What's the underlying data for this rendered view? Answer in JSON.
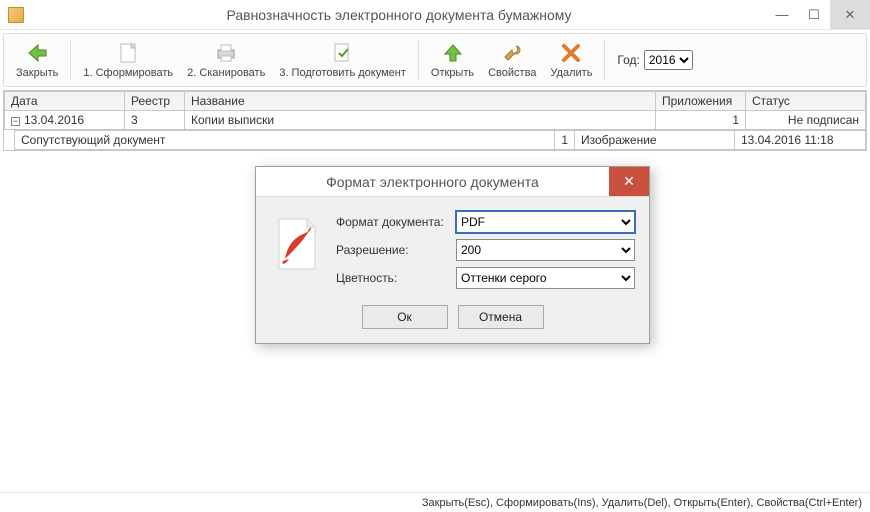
{
  "window": {
    "title": "Равнозначность электронного документа бумажному"
  },
  "toolbar": {
    "close": "Закрыть",
    "form": "1. Сформировать",
    "scan": "2. Сканировать",
    "prepare": "3. Подготовить документ",
    "open": "Открыть",
    "props": "Свойства",
    "delete": "Удалить",
    "year_label": "Год:",
    "year_value": "2016"
  },
  "grid": {
    "headers": {
      "date": "Дата",
      "registry": "Реестр",
      "name": "Название",
      "attachments": "Приложения",
      "status": "Статус"
    },
    "row1": {
      "date": "13.04.2016",
      "registry": "3",
      "name": "Копии выписки",
      "attachments": "1",
      "status": "Не подписан"
    },
    "row2": {
      "doc_type": "Сопутствующий документ",
      "num": "1",
      "image": "Изображение",
      "ts": "13.04.2016 11:18"
    }
  },
  "modal": {
    "title": "Формат электронного документа",
    "labels": {
      "format": "Формат документа:",
      "resolution": "Разрешение:",
      "color": "Цветность:"
    },
    "values": {
      "format": "PDF",
      "resolution": "200",
      "color": "Оттенки серого"
    },
    "ok": "Ок",
    "cancel": "Отмена"
  },
  "status": {
    "hints": "Закрыть(Esc), Сформировать(Ins), Удалить(Del), Открыть(Enter), Свойства(Ctrl+Enter)"
  }
}
